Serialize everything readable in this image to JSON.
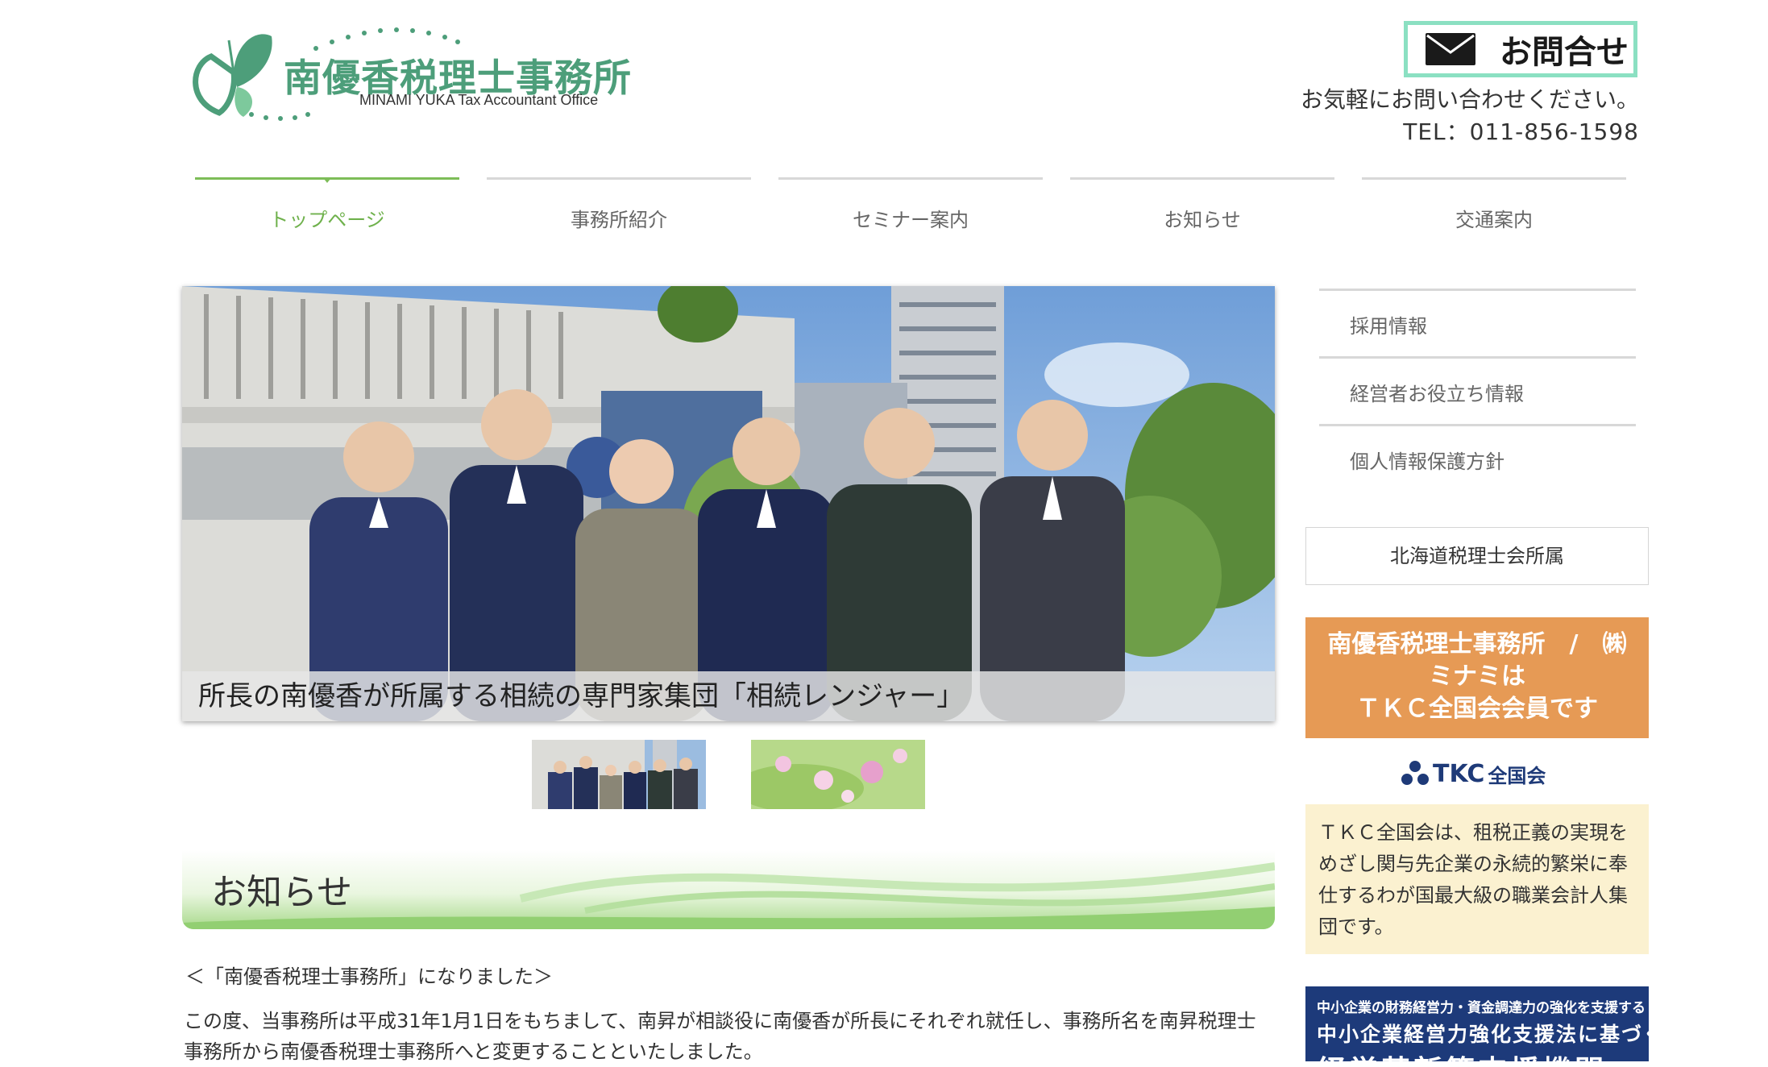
{
  "header": {
    "logo_title": "南優香税理士事務所",
    "logo_subtitle": "MINAMI YUKA Tax Accountant Office",
    "contact_label": "お問合せ",
    "contact_note": "お気軽にお問い合わせください。",
    "tel": "TEL：011-856-1598"
  },
  "nav": {
    "items": [
      {
        "label": "トップページ"
      },
      {
        "label": "事務所紹介"
      },
      {
        "label": "セミナー案内"
      },
      {
        "label": "お知らせ"
      },
      {
        "label": "交通案内"
      }
    ]
  },
  "hero": {
    "caption": "所長の南優香が所属する相続の専門家集団「相続レンジャー」"
  },
  "news": {
    "heading": "お知らせ",
    "subtitle": "＜「南優香税理士事務所」になりました＞",
    "body": "この度、当事務所は平成31年1月1日をもちまして、南昇が相談役に南優香が所長にそれぞれ就任し、事務所名を南昇税理士事務所から南優香税理士事務所へと変更することといたしました。"
  },
  "sidebar": {
    "links": [
      {
        "label": "採用情報"
      },
      {
        "label": "経営者お役立ち情報"
      },
      {
        "label": "個人情報保護方針"
      }
    ],
    "association": "北海道税理士会所属",
    "tkc_banner_line1": "南優香税理士事務所　/　㈱",
    "tkc_banner_line2": "ミナミは",
    "tkc_banner_line3": "ＴＫＣ全国会会員です",
    "tkc_logo_text": "TKC",
    "tkc_logo_sub": "全国会",
    "tkc_description": "ＴＫＣ全国会は、租税正義の実現をめざし関与先企業の永続的繁栄に奉仕するわが国最大級の職業会計人集団です。",
    "bottom_banner_line1": "中小企業の財務経営力・資金調達力の強化を支援する",
    "bottom_banner_line2": "中小企業経営力強化支援法に基づく",
    "bottom_banner_line3": "経営革新等支援機関"
  },
  "colors": {
    "accent_green": "#6fb14c",
    "logo_green": "#4d9e7a",
    "contact_border": "#8be0c2",
    "tkc_orange": "#e69a55",
    "tkc_desc_bg": "#fbf1d0",
    "tkc_navy": "#1d3a7a"
  }
}
